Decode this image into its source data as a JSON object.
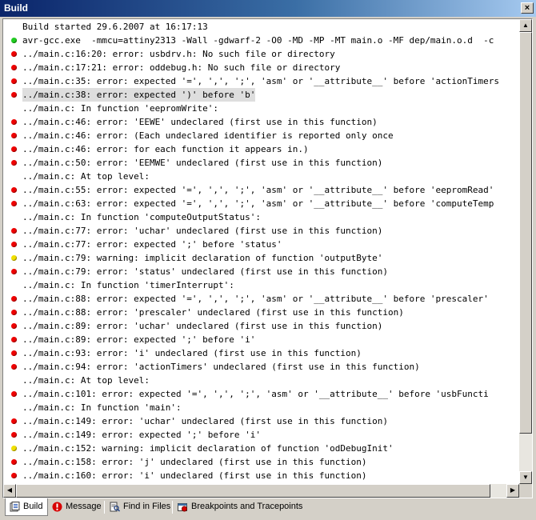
{
  "window": {
    "title": "Build",
    "close_label": "×"
  },
  "output_lines": [
    {
      "icon": "none",
      "text": "Build started 29.6.2007 at 16:17:13"
    },
    {
      "icon": "ok",
      "text": "avr-gcc.exe  -mmcu=attiny2313 -Wall -gdwarf-2 -O0 -MD -MP -MT main.o -MF dep/main.o.d  -c"
    },
    {
      "icon": "error",
      "text": "../main.c:16:20: error: usbdrv.h: No such file or directory"
    },
    {
      "icon": "error",
      "text": "../main.c:17:21: error: oddebug.h: No such file or directory"
    },
    {
      "icon": "error",
      "text": "../main.c:35: error: expected '=', ',', ';', 'asm' or '__attribute__' before 'actionTimers"
    },
    {
      "icon": "error",
      "text": "../main.c:38: error: expected ')' before 'b'",
      "selected": true
    },
    {
      "icon": "none",
      "text": "../main.c: In function 'eepromWrite':"
    },
    {
      "icon": "error",
      "text": "../main.c:46: error: 'EEWE' undeclared (first use in this function)"
    },
    {
      "icon": "error",
      "text": "../main.c:46: error: (Each undeclared identifier is reported only once"
    },
    {
      "icon": "error",
      "text": "../main.c:46: error: for each function it appears in.)"
    },
    {
      "icon": "error",
      "text": "../main.c:50: error: 'EEMWE' undeclared (first use in this function)"
    },
    {
      "icon": "none",
      "text": "../main.c: At top level:"
    },
    {
      "icon": "error",
      "text": "../main.c:55: error: expected '=', ',', ';', 'asm' or '__attribute__' before 'eepromRead'"
    },
    {
      "icon": "error",
      "text": "../main.c:63: error: expected '=', ',', ';', 'asm' or '__attribute__' before 'computeTemp"
    },
    {
      "icon": "none",
      "text": "../main.c: In function 'computeOutputStatus':"
    },
    {
      "icon": "error",
      "text": "../main.c:77: error: 'uchar' undeclared (first use in this function)"
    },
    {
      "icon": "error",
      "text": "../main.c:77: error: expected ';' before 'status'"
    },
    {
      "icon": "warning",
      "text": "../main.c:79: warning: implicit declaration of function 'outputByte'"
    },
    {
      "icon": "error",
      "text": "../main.c:79: error: 'status' undeclared (first use in this function)"
    },
    {
      "icon": "none",
      "text": "../main.c: In function 'timerInterrupt':"
    },
    {
      "icon": "error",
      "text": "../main.c:88: error: expected '=', ',', ';', 'asm' or '__attribute__' before 'prescaler'"
    },
    {
      "icon": "error",
      "text": "../main.c:88: error: 'prescaler' undeclared (first use in this function)"
    },
    {
      "icon": "error",
      "text": "../main.c:89: error: 'uchar' undeclared (first use in this function)"
    },
    {
      "icon": "error",
      "text": "../main.c:89: error: expected ';' before 'i'"
    },
    {
      "icon": "error",
      "text": "../main.c:93: error: 'i' undeclared (first use in this function)"
    },
    {
      "icon": "error",
      "text": "../main.c:94: error: 'actionTimers' undeclared (first use in this function)"
    },
    {
      "icon": "none",
      "text": "../main.c: At top level:"
    },
    {
      "icon": "error",
      "text": "../main.c:101: error: expected '=', ',', ';', 'asm' or '__attribute__' before 'usbFuncti"
    },
    {
      "icon": "none",
      "text": "../main.c: In function 'main':"
    },
    {
      "icon": "error",
      "text": "../main.c:149: error: 'uchar' undeclared (first use in this function)"
    },
    {
      "icon": "error",
      "text": "../main.c:149: error: expected ';' before 'i'"
    },
    {
      "icon": "warning",
      "text": "../main.c:152: warning: implicit declaration of function 'odDebugInit'"
    },
    {
      "icon": "error",
      "text": "../main.c:158: error: 'j' undeclared (first use in this function)"
    },
    {
      "icon": "error",
      "text": "../main.c:160: error: 'i' undeclared (first use in this function)"
    }
  ],
  "tabs": [
    {
      "label": "Build",
      "icon": "build-icon",
      "active": true
    },
    {
      "label": "Message",
      "icon": "info-icon",
      "active": false
    },
    {
      "label": "Find in Files",
      "icon": "find-files-icon",
      "active": false
    },
    {
      "label": "Breakpoints and Tracepoints",
      "icon": "breakpoints-icon",
      "active": false
    }
  ],
  "colors": {
    "error": "#ee0000",
    "warning": "#f0e000",
    "ok": "#22cc22",
    "title_bar": "#0a246a"
  }
}
